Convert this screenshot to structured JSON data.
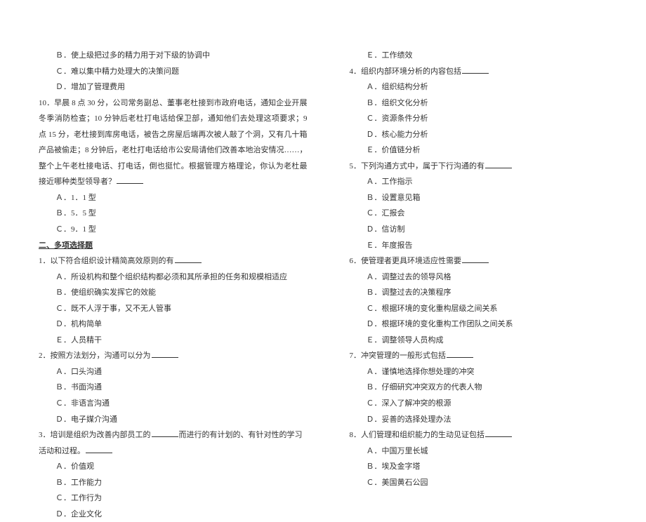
{
  "left": {
    "q9_opts": {
      "b": "Ｂ．使上级把过多的精力用于对下级的协调中",
      "c": "Ｃ．难以集中精力处理大的决策问题",
      "d": "Ｄ．增加了管理费用"
    },
    "q10": {
      "stem": "10．早晨 8 点 30 分，公司常务副总、董事老杜接到市政府电话，通知企业开展冬季消防检查；10 分钟后老杜打电话给保卫部，通知他们去处理这项要求；9 点 15 分，老杜接到库房电话，被告之房屋后端再次被人敲了个洞，又有几十箱产品被偷走；8 分钟后，老杜打电话给市公安局请他们改善本地治安情况……，整个上午老杜接电话、打电话，倒也挺忙。根据管理方格理论，你认为老杜最接近哪种类型领导者？",
      "a": "Ａ．1．1 型",
      "b": "Ｂ．5．5 型",
      "c": "Ｃ．9．1 型"
    },
    "section2": "二、多项选择题",
    "m1": {
      "stem": "1．以下符合组织设计精简高效原则的有",
      "a": "Ａ．所设机构和整个组织结构都必须和其所承担的任务和规模相适应",
      "b": "Ｂ．使组织确实发挥它的效能",
      "c": "Ｃ．既不人浮于事，又不无人管事",
      "d": "Ｄ．机构简单",
      "e": "Ｅ．人员精干"
    },
    "m2": {
      "stem": "2．按照方法划分，沟通可以分为",
      "a": "Ａ．口头沟通",
      "b": "Ｂ．书面沟通",
      "c": "Ｃ．非语言沟通",
      "d": "Ｄ．电子媒介沟通"
    },
    "m3": {
      "stem_pre": "3．培训是组织为改善内部员工的",
      "stem_post": "而进行的有计划的、有针对性的学习活动和过程。",
      "a": "Ａ．价值观",
      "b": "Ｂ．工作能力",
      "c": "Ｃ．工作行为",
      "d": "Ｄ．企业文化"
    }
  },
  "right": {
    "m3e": "Ｅ．工作绩效",
    "m4": {
      "stem": "4．组织内部环境分析的内容包括",
      "a": "Ａ．组织结构分析",
      "b": "Ｂ．组织文化分析",
      "c": "Ｃ．资源条件分析",
      "d": "Ｄ．核心能力分析",
      "e": "Ｅ．价值链分析"
    },
    "m5": {
      "stem": "5．下列沟通方式中，属于下行沟通的有",
      "a": "Ａ．工作指示",
      "b": "Ｂ．设置意见箱",
      "c": "Ｃ．汇报会",
      "d": "Ｄ．信访制",
      "e": "Ｅ．年度报告"
    },
    "m6": {
      "stem": "6．使管理者更具环境适应性需要",
      "a": "Ａ．调整过去的领导风格",
      "b": "Ｂ．调整过去的决策程序",
      "c": "Ｃ．根据环境的变化重构层级之间关系",
      "d": "Ｄ．根据环境的变化重构工作团队之间关系",
      "e": "Ｅ．调整领导人员构成"
    },
    "m7": {
      "stem": "7．冲突管理的一般形式包括",
      "a": "Ａ．谨慎地选择你想处理的冲突",
      "b": "Ｂ．仔细研究冲突双方的代表人物",
      "c": "Ｃ．深入了解冲突的根源",
      "d": "Ｄ．妥善的选择处理办法"
    },
    "m8": {
      "stem": "8．人们管理和组织能力的生动见证包括",
      "a": "Ａ．中国万里长城",
      "b": "Ｂ．埃及金字塔",
      "c": "Ｃ．美国黄石公园"
    }
  }
}
